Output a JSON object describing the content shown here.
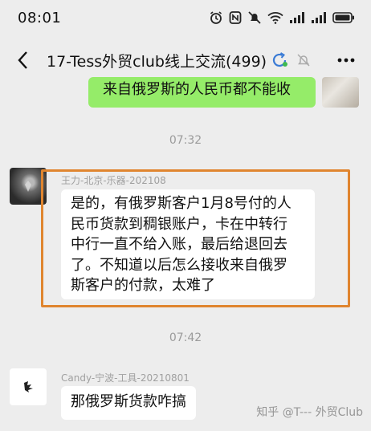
{
  "status_bar": {
    "time": "08:01",
    "icons": [
      "alarm-icon",
      "nfc-icon",
      "mute-icon",
      "wifi-icon",
      "signal-icon",
      "signal-icon",
      "battery-icon"
    ]
  },
  "header": {
    "title": "17-Tess外贸club线上交流(499)",
    "icons": [
      "back-arrow-icon",
      "refresh-icon",
      "mute-bell-icon",
      "more-icon"
    ]
  },
  "messages": [
    {
      "direction": "out",
      "text": "来自俄罗斯的人民币都不能收"
    },
    {
      "type": "time",
      "text": "07:32"
    },
    {
      "direction": "in",
      "sender": "王力-北京-乐器-202108",
      "lines": [
        "是的，有俄罗斯客户1月8号付的人",
        "民币货款到稠银账户，卡在中转行",
        "中行一直不给入账，最后给退回去",
        "了。不知道以后怎么接收来自俄罗",
        "斯客户的付款，太难了"
      ],
      "highlighted": true
    },
    {
      "type": "time",
      "text": "07:42"
    },
    {
      "direction": "in",
      "sender": "Candy-宁波-工具-20210801",
      "text": "那俄罗斯货款咋搞"
    }
  ],
  "watermark": "知乎 @T--- 外贸Club",
  "colors": {
    "background": "#ededed",
    "outgoing_bubble": "#95ec69",
    "incoming_bubble": "#ffffff",
    "highlight_box": "#e0852f",
    "muted_text": "#9b9b9b"
  }
}
